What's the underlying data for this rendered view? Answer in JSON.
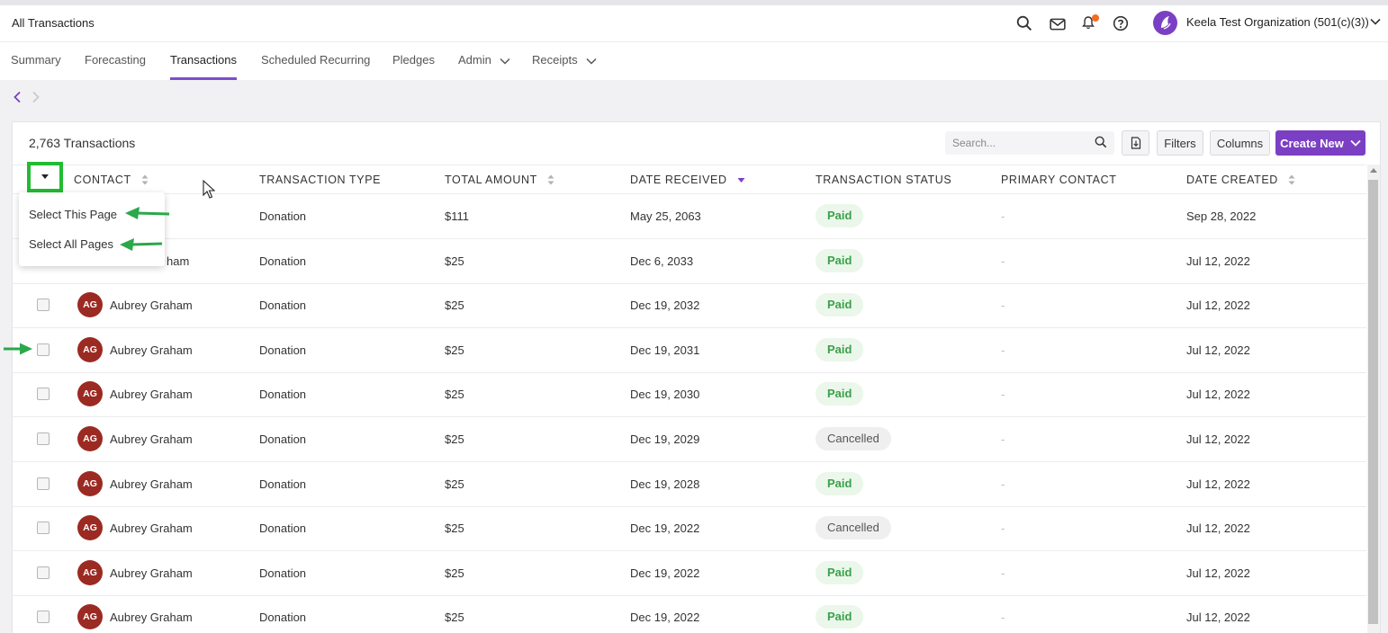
{
  "header": {
    "title": "All Transactions",
    "org_name": "Keela Test Organization (501(c)(3))",
    "icons": [
      "search-icon",
      "mail-icon",
      "bell-icon",
      "help-icon"
    ]
  },
  "nav": {
    "tabs": [
      {
        "label": "Summary",
        "active": false
      },
      {
        "label": "Forecasting",
        "active": false
      },
      {
        "label": "Transactions",
        "active": true
      },
      {
        "label": "Scheduled Recurring",
        "active": false
      },
      {
        "label": "Pledges",
        "active": false
      },
      {
        "label": "Admin",
        "active": false,
        "dropdown": true
      },
      {
        "label": "Receipts",
        "active": false,
        "dropdown": true
      }
    ]
  },
  "toolbar": {
    "count": "2,763 Transactions",
    "search_placeholder": "Search...",
    "filters_label": "Filters",
    "columns_label": "Columns",
    "create_label": "Create New"
  },
  "table": {
    "headers": [
      "CONTACT",
      "TRANSACTION TYPE",
      "TOTAL AMOUNT",
      "DATE RECEIVED",
      "TRANSACTION STATUS",
      "PRIMARY CONTACT",
      "DATE CREATED"
    ],
    "rows": [
      {
        "initials": "",
        "contact": "",
        "type": "Donation",
        "amount": "$111",
        "received": "May 25, 2063",
        "status": "Paid",
        "primary": "-",
        "created": "Sep 28, 2022"
      },
      {
        "initials": "",
        "contact": "ham",
        "type": "Donation",
        "amount": "$25",
        "received": "Dec 6, 2033",
        "status": "Paid",
        "primary": "-",
        "created": "Jul 12, 2022"
      },
      {
        "initials": "AG",
        "contact": "Aubrey Graham",
        "type": "Donation",
        "amount": "$25",
        "received": "Dec 19, 2032",
        "status": "Paid",
        "primary": "-",
        "created": "Jul 12, 2022"
      },
      {
        "initials": "AG",
        "contact": "Aubrey Graham",
        "type": "Donation",
        "amount": "$25",
        "received": "Dec 19, 2031",
        "status": "Paid",
        "primary": "-",
        "created": "Jul 12, 2022"
      },
      {
        "initials": "AG",
        "contact": "Aubrey Graham",
        "type": "Donation",
        "amount": "$25",
        "received": "Dec 19, 2030",
        "status": "Paid",
        "primary": "-",
        "created": "Jul 12, 2022"
      },
      {
        "initials": "AG",
        "contact": "Aubrey Graham",
        "type": "Donation",
        "amount": "$25",
        "received": "Dec 19, 2029",
        "status": "Cancelled",
        "primary": "-",
        "created": "Jul 12, 2022"
      },
      {
        "initials": "AG",
        "contact": "Aubrey Graham",
        "type": "Donation",
        "amount": "$25",
        "received": "Dec 19, 2028",
        "status": "Paid",
        "primary": "-",
        "created": "Jul 12, 2022"
      },
      {
        "initials": "AG",
        "contact": "Aubrey Graham",
        "type": "Donation",
        "amount": "$25",
        "received": "Dec 19, 2022",
        "status": "Cancelled",
        "primary": "-",
        "created": "Jul 12, 2022"
      },
      {
        "initials": "AG",
        "contact": "Aubrey Graham",
        "type": "Donation",
        "amount": "$25",
        "received": "Dec 19, 2022",
        "status": "Paid",
        "primary": "-",
        "created": "Jul 12, 2022"
      },
      {
        "initials": "AG",
        "contact": "Aubrey Graham",
        "type": "Donation",
        "amount": "$25",
        "received": "Dec 19, 2022",
        "status": "Paid",
        "primary": "-",
        "created": "Jul 12, 2022"
      }
    ]
  },
  "select_menu": {
    "items": [
      "Select This Page",
      "Select All Pages"
    ]
  },
  "colors": {
    "brand": "#7b3fc4",
    "highlight": "#22bb33",
    "paid": "#3aa14a",
    "avatar": "#9b2a22",
    "notification": "#f26d21"
  }
}
